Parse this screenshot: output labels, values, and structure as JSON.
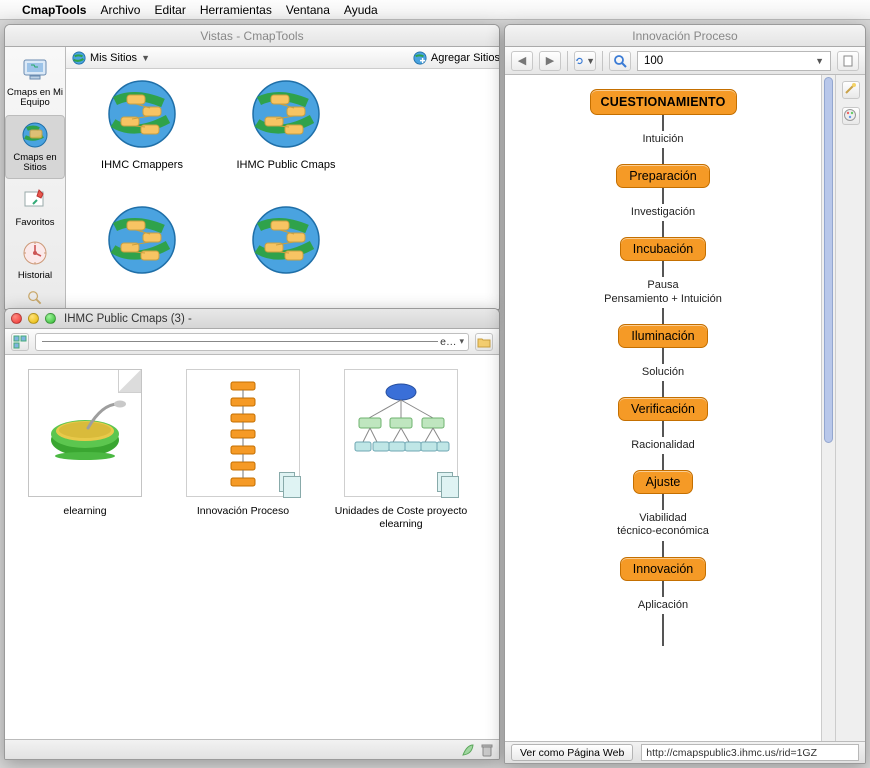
{
  "menubar": {
    "app": "CmapTools",
    "items": [
      "Archivo",
      "Editar",
      "Herramientas",
      "Ventana",
      "Ayuda"
    ]
  },
  "vistas": {
    "title": "Vistas - CmapTools",
    "toolbar": {
      "my_sites": "Mis Sitios",
      "add_sites": "Agregar Sitios"
    },
    "sidebar": [
      {
        "label": "Cmaps en Mi Equipo",
        "name": "sidebar-cmaps-equipo"
      },
      {
        "label": "Cmaps en Sitios",
        "name": "sidebar-cmaps-sitios",
        "selected": true
      },
      {
        "label": "Favoritos",
        "name": "sidebar-favoritos"
      },
      {
        "label": "Historial",
        "name": "sidebar-historial"
      }
    ],
    "sites": [
      {
        "label": "IHMC Cmappers"
      },
      {
        "label": "IHMC Public Cmaps"
      },
      {
        "label": ""
      },
      {
        "label": "",
        "selected": true
      }
    ]
  },
  "ihmc": {
    "title": "IHMC Public Cmaps (3) - ",
    "breadcrumb_suffix": "e…",
    "files": [
      {
        "label": "elearning",
        "type": "image"
      },
      {
        "label": "Innovación Proceso",
        "type": "cmap-vertical"
      },
      {
        "label": "Unidades de Coste proyecto elearning",
        "type": "cmap-tree"
      }
    ]
  },
  "diagram": {
    "title": "Innovación Proceso",
    "zoom": "100",
    "nodes": [
      "CUESTIONAMIENTO",
      "Preparación",
      "Incubación",
      "Iluminación",
      "Verificación",
      "Ajuste",
      "Innovación"
    ],
    "links": [
      "Intuición",
      "Investigación",
      "Pausa\nPensamiento + Intuición",
      "Solución",
      "Racionalidad",
      "Viabilidad\ntécnico-económica",
      "Aplicación"
    ],
    "web_button": "Ver como Página Web",
    "url": "http://cmapspublic3.ihmc.us/rid=1GZ"
  }
}
